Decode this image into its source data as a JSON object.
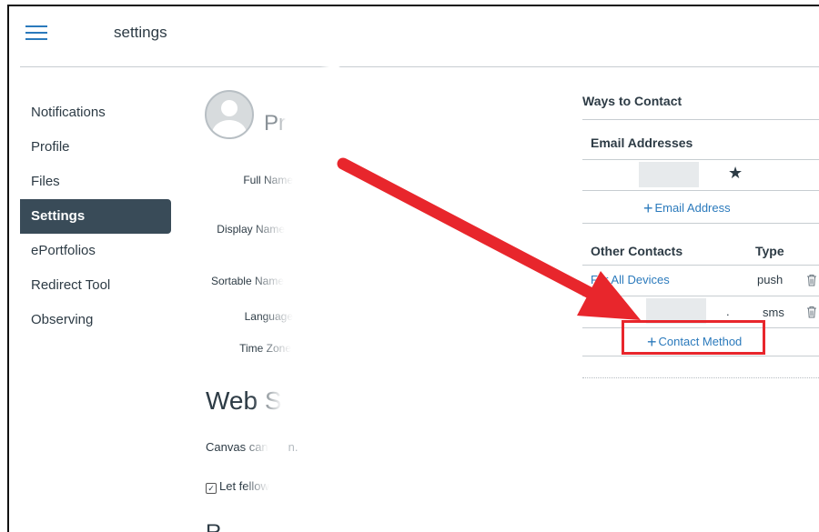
{
  "header": {
    "breadcrumb": "settings",
    "menu_icon": "hamburger-icon"
  },
  "nav": {
    "items": [
      "Notifications",
      "Profile",
      "Files",
      "Settings",
      "ePortfolios",
      "Redirect Tool",
      "Observing"
    ],
    "active": "Settings"
  },
  "profile": {
    "title_partial": "Pr",
    "labels": [
      "Full Name",
      "Display Name",
      "Sortable Name",
      "Language",
      "Time Zone"
    ],
    "web_title_partial": "Web S",
    "canvas_text_start": "Canvas can",
    "canvas_text_end": "n.",
    "let_fellow": "Let fellow",
    "bottom_text": "R..."
  },
  "contact": {
    "title": "Ways to Contact",
    "email_header": "Email Addresses",
    "add_email": "Email Address",
    "other_header": "Other Contacts",
    "type_header": "Type",
    "rows": [
      {
        "name": "For All Devices",
        "type": "push"
      },
      {
        "name": ".",
        "type": "sms"
      }
    ],
    "add_contact": "Contact Method",
    "colors": {
      "link": "#2b7abc",
      "highlight": "#e8262c"
    }
  }
}
